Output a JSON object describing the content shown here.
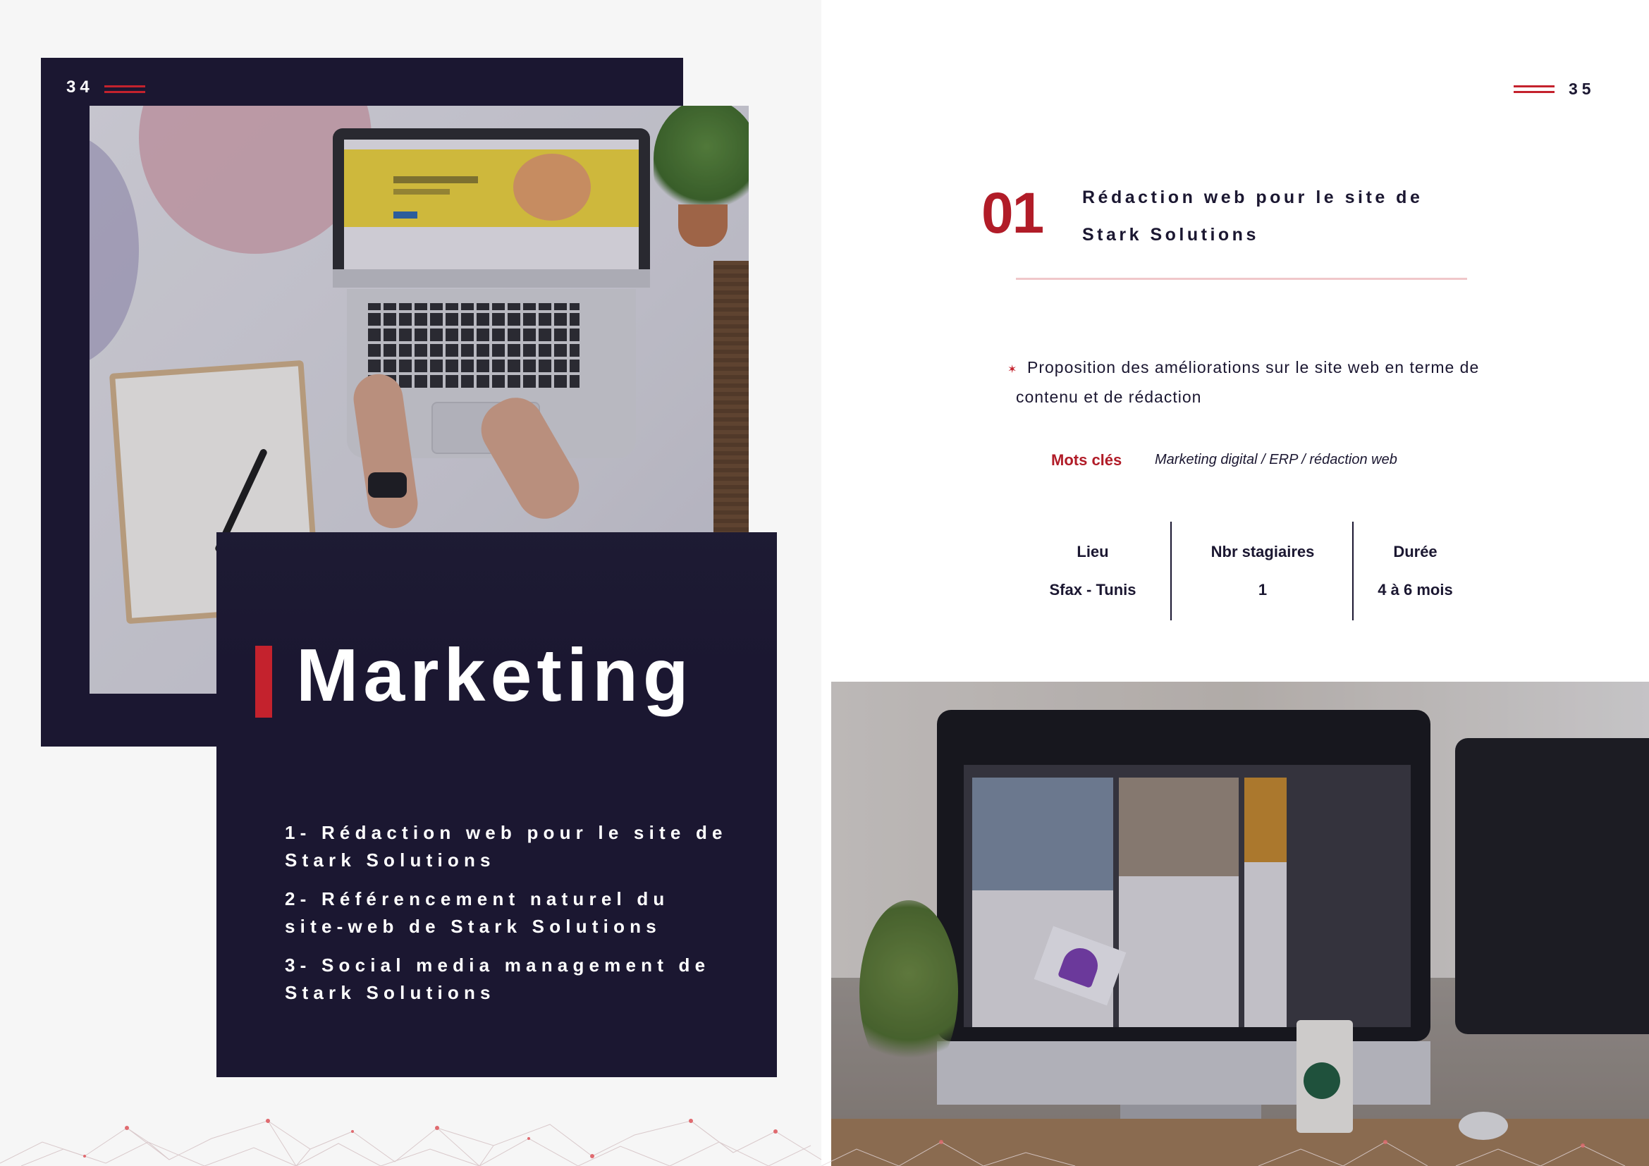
{
  "left_page": {
    "page_number": "34",
    "title": "Marketing",
    "list": [
      "1- Rédaction web pour le site de Stark Solutions",
      "2- Référencement naturel du site-web de Stark Solutions",
      "3- Social media management de Stark Solutions"
    ]
  },
  "right_page": {
    "page_number": "35",
    "number": "01",
    "heading": "Rédaction web pour le site de Stark Solutions",
    "description": "Proposition des améliorations sur le site web en terme de contenu et de rédaction",
    "keywords_label": "Mots clés",
    "keywords": "Marketing digital / ERP / rédaction web",
    "info": [
      {
        "label": "Lieu",
        "value": "Sfax - Tunis"
      },
      {
        "label": "Nbr stagiaires",
        "value": "1"
      },
      {
        "label": "Durée",
        "value": "4 à 6 mois"
      }
    ]
  },
  "colors": {
    "navy": "#1b1731",
    "accent_red": "#c4222d",
    "dark_red": "#b11c28",
    "divider_pink": "#f0c7ca"
  },
  "icons": [
    "double-line-icon",
    "star-bullet-icon",
    "network-pattern-icon"
  ],
  "images": {
    "left_photo": "laptop-workspace-photo",
    "right_photo": "imac-desk-photo"
  }
}
